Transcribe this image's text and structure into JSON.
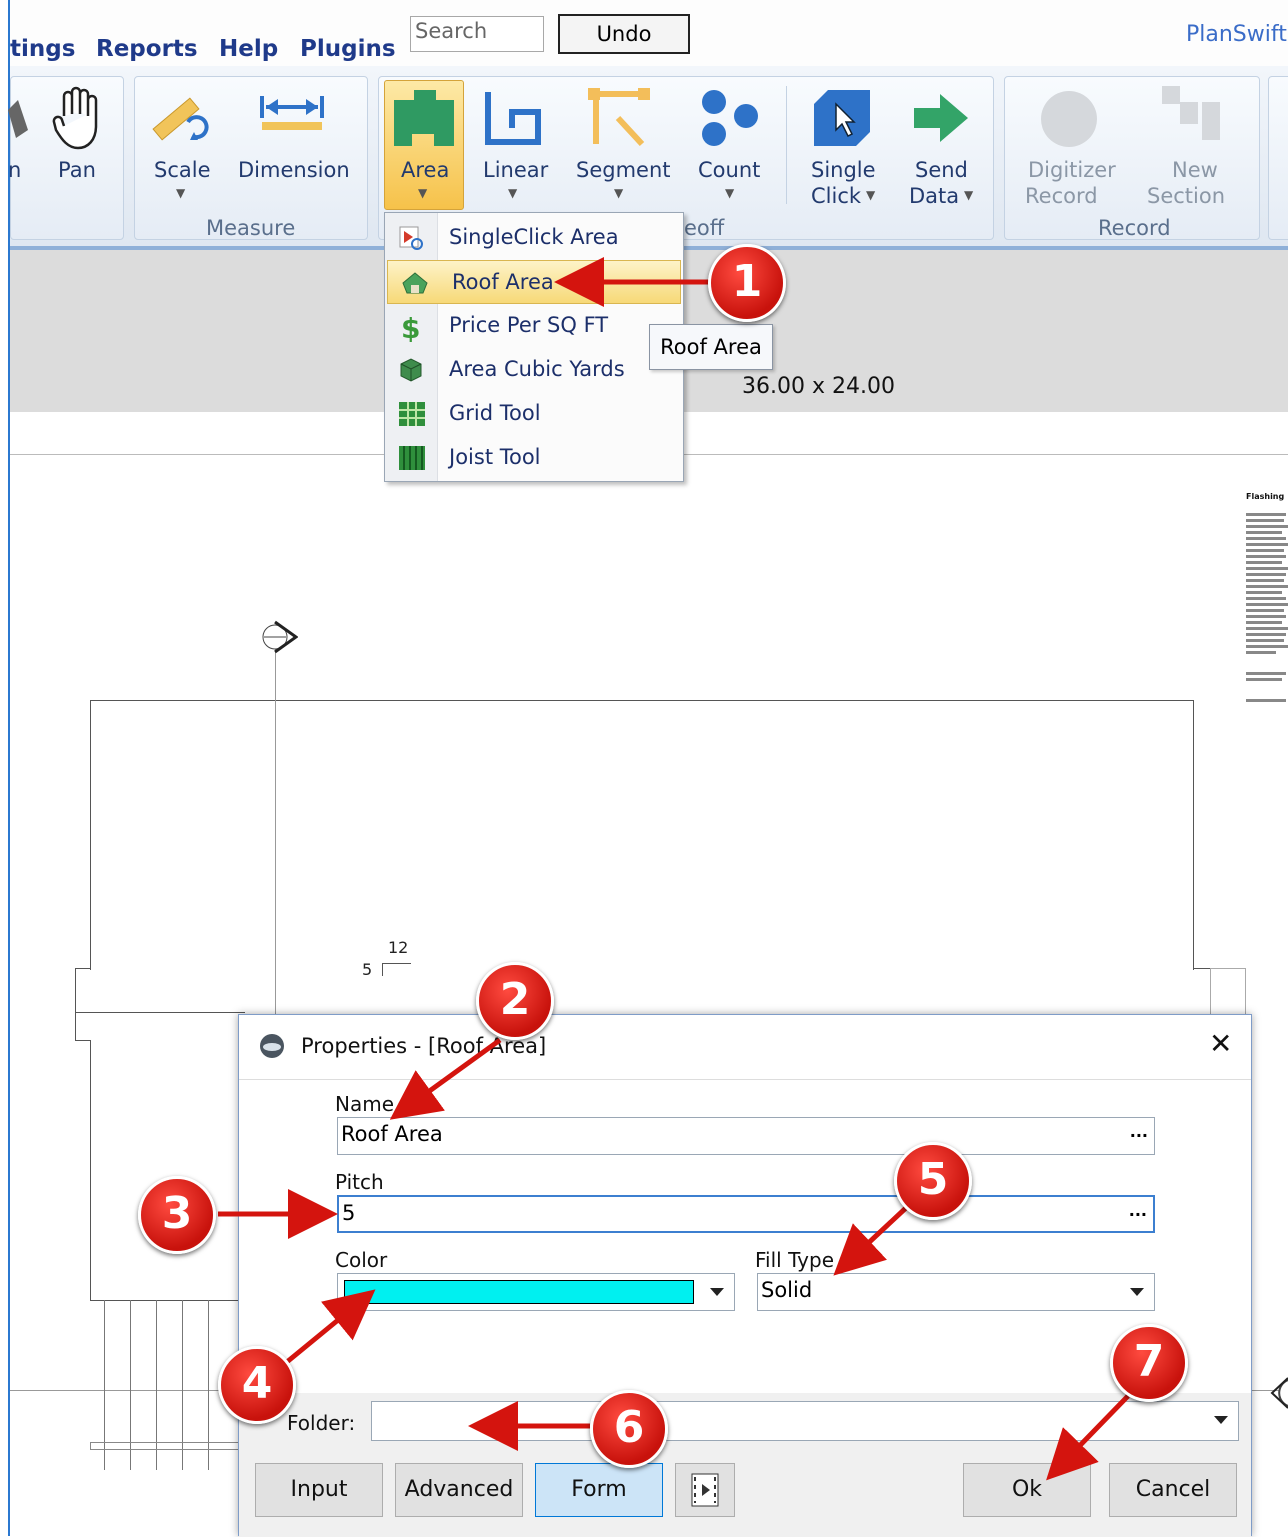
{
  "menu": {
    "settings": "tings",
    "reports": "Reports",
    "help": "Help",
    "plugins": "Plugins"
  },
  "search": {
    "placeholder": "Search"
  },
  "undo_label": "Undo",
  "app_title": "PlanSwift",
  "ribbon": {
    "partial_tool": "n",
    "pan": "Pan",
    "scale": "Scale",
    "dimension": "Dimension",
    "measure_group": "Measure",
    "area": "Area",
    "linear": "Linear",
    "segment": "Segment",
    "count": "Count",
    "single_click_1": "Single",
    "single_click_2": "Click",
    "send_data_1": "Send",
    "send_data_2": "Data",
    "takeoff_group_partial": "eoff",
    "digitizer_1": "Digitizer",
    "digitizer_2": "Record",
    "new_section_1": "New",
    "new_section_2": "Section",
    "record_group": "Record"
  },
  "area_menu": {
    "items": [
      {
        "label": "SingleClick Area",
        "icon": "singleclick-area-icon"
      },
      {
        "label": "Roof Area",
        "icon": "roof-area-icon"
      },
      {
        "label": "Price Per SQ FT",
        "icon": "dollar-icon"
      },
      {
        "label": "Area Cubic Yards",
        "icon": "cube-icon"
      },
      {
        "label": "Grid Tool",
        "icon": "grid-icon"
      },
      {
        "label": "Joist Tool",
        "icon": "joist-icon"
      }
    ]
  },
  "tooltip": "Roof Area",
  "drawing": {
    "dimension_text": "36.00 x 24.00",
    "pitch_rise": "5",
    "pitch_run": "12",
    "notes_heading": "Flashing"
  },
  "dialog": {
    "title": "Properties - [Roof Area]",
    "name_label": "Name",
    "name_value": "Roof Area",
    "pitch_label": "Pitch",
    "pitch_value": "5",
    "color_label": "Color",
    "color_value": "#00f0f0",
    "filltype_label": "Fill Type",
    "filltype_value": "Solid",
    "folder_label": "Folder:",
    "folder_value": "",
    "buttons": {
      "input": "Input",
      "advanced": "Advanced",
      "form": "Form",
      "ok": "Ok",
      "cancel": "Cancel"
    }
  },
  "callouts": [
    "1",
    "2",
    "3",
    "4",
    "5",
    "6",
    "7"
  ],
  "colors": {
    "accent": "#2b78d0",
    "callout": "#d4140e",
    "highlight": "#f7d978"
  }
}
